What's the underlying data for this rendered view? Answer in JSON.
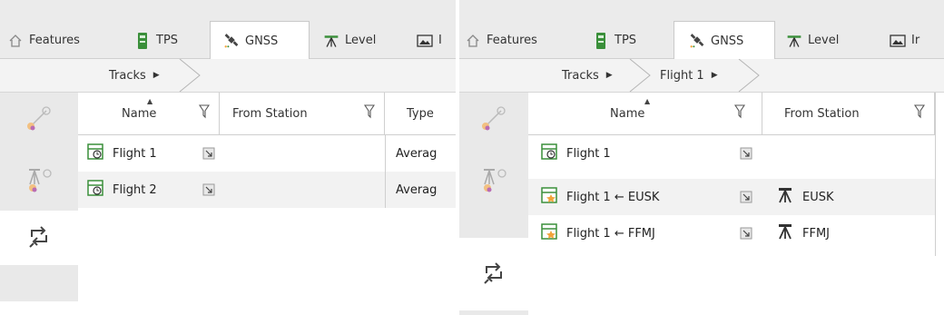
{
  "left_panel": {
    "tabs": [
      {
        "label": "Features",
        "icon": "features-icon"
      },
      {
        "label": "TPS",
        "icon": "tps-icon"
      },
      {
        "label": "GNSS",
        "icon": "gnss-satellite-icon",
        "active": true
      },
      {
        "label": "Level",
        "icon": "level-icon"
      },
      {
        "label": "I",
        "icon": "image-icon"
      }
    ],
    "breadcrumbs": [
      {
        "label": "Tracks"
      }
    ],
    "columns": [
      "Name",
      "From Station",
      "Type"
    ],
    "rows": [
      {
        "name": "Flight 1",
        "from_station": "",
        "type": "Averag"
      },
      {
        "name": "Flight 2",
        "from_station": "",
        "type": "Averag"
      }
    ]
  },
  "right_panel": {
    "tabs": [
      {
        "label": "Features",
        "icon": "features-icon"
      },
      {
        "label": "TPS",
        "icon": "tps-icon"
      },
      {
        "label": "GNSS",
        "icon": "gnss-satellite-icon",
        "active": true
      },
      {
        "label": "Level",
        "icon": "level-icon"
      },
      {
        "label": "Ir",
        "icon": "image-icon"
      }
    ],
    "breadcrumbs": [
      {
        "label": "Tracks"
      },
      {
        "label": "Flight 1"
      }
    ],
    "columns": [
      "Name",
      "From Station"
    ],
    "rows": [
      {
        "name": "Flight 1",
        "from_station": ""
      },
      {
        "name": "Flight 1 ← EUSK",
        "from_station": "EUSK"
      },
      {
        "name": "Flight 1 ← FFMJ",
        "from_station": "FFMJ"
      }
    ]
  },
  "colors": {
    "accent_green": "#3a8f3a",
    "accent_orange": "#f2a33a",
    "tab_bar": "#ebebeb",
    "strip": "#e9e9e9"
  }
}
